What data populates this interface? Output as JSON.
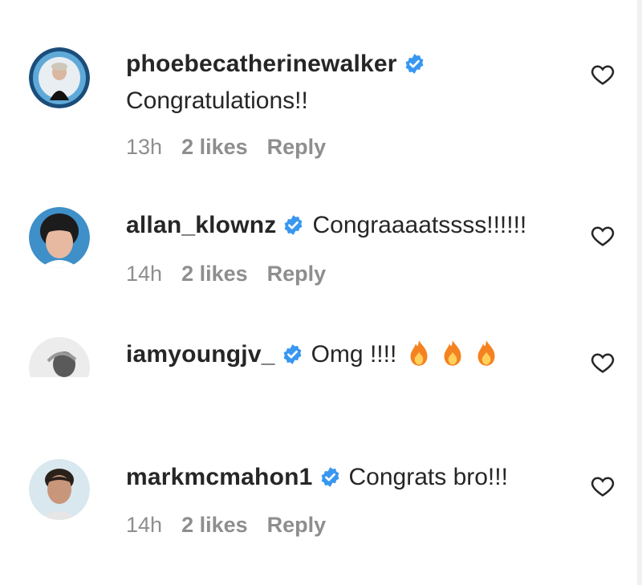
{
  "comments": [
    {
      "username": "phoebecatherinewalker",
      "text": "Congratulations!!",
      "time": "13h",
      "likes": "2 likes",
      "reply": "Reply"
    },
    {
      "username": "allan_klownz",
      "text": "Congraaaatssss!!!!!!",
      "time": "14h",
      "likes": "2 likes",
      "reply": "Reply"
    },
    {
      "username": "iamyoungjv_",
      "text": "Omg !!!!",
      "emoji": "fire-icon x3"
    },
    {
      "username": "markmcmahon1",
      "text": "Congrats bro!!!",
      "time": "14h",
      "likes": "2 likes",
      "reply": "Reply"
    }
  ],
  "colors": {
    "verified": "#3897f0",
    "meta": "#8e8e8e",
    "text": "#262626",
    "fire": "#f58220"
  }
}
